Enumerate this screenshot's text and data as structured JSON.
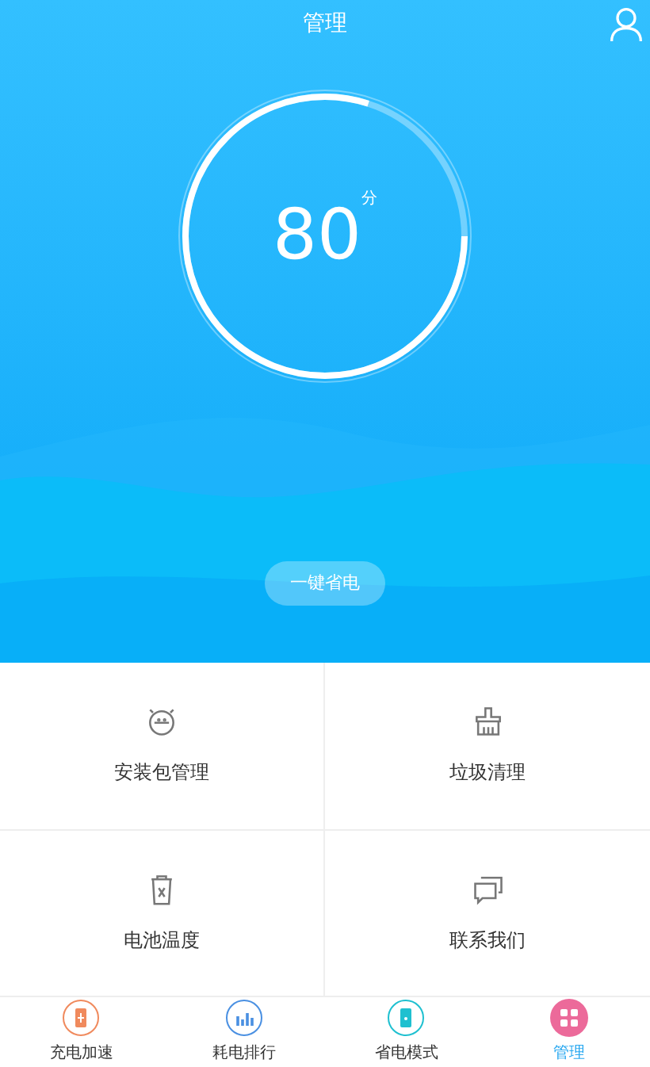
{
  "header": {
    "title": "管理"
  },
  "gauge": {
    "score": "80",
    "unit": "分",
    "level": 0.8
  },
  "save_button": "一键省电",
  "grid": [
    {
      "kind": "package",
      "label": "安装包管理"
    },
    {
      "kind": "broom",
      "label": "垃圾清理"
    },
    {
      "kind": "trash",
      "label": "电池温度"
    },
    {
      "kind": "chat",
      "label": "联系我们"
    }
  ],
  "tabs": [
    {
      "kind": "charge",
      "label": "充电加速",
      "color": "#f08a5d",
      "selected": false
    },
    {
      "kind": "bars",
      "label": "耗电排行",
      "color": "#4a90e2",
      "selected": false
    },
    {
      "kind": "battery",
      "label": "省电模式",
      "color": "#1fc0d0",
      "selected": false
    },
    {
      "kind": "grid",
      "label": "管理",
      "color": "#ec6a9a",
      "selected": true
    }
  ]
}
